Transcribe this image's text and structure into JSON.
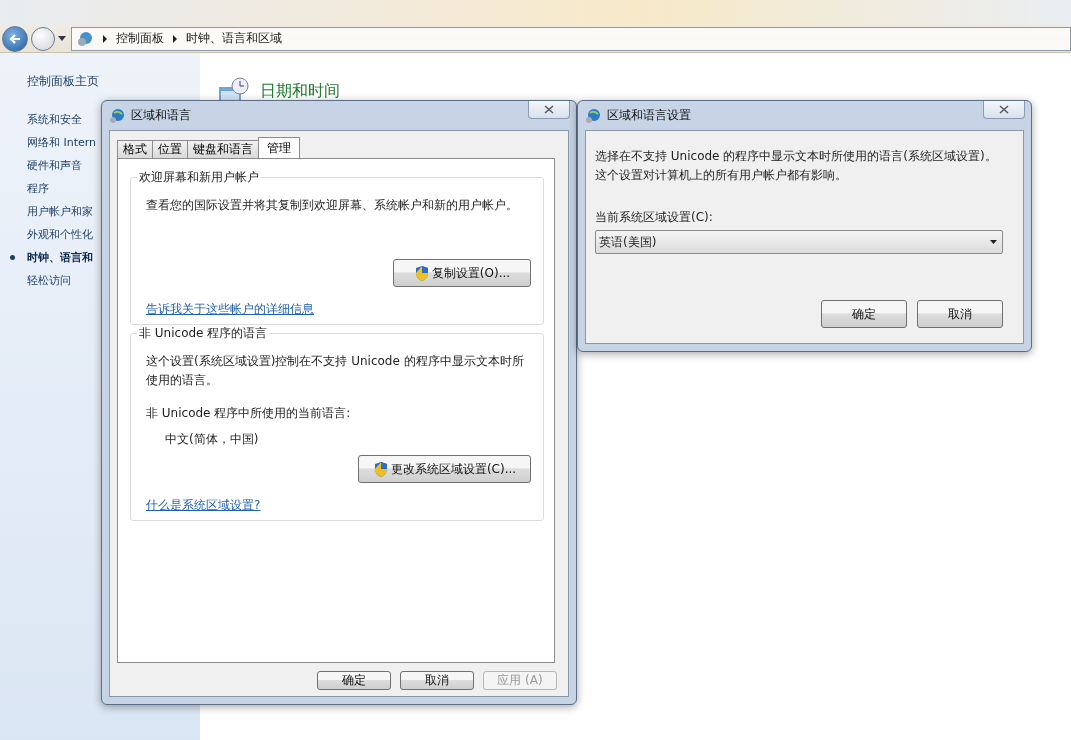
{
  "window": {
    "breadcrumb": [
      "控制面板",
      "时钟、语言和区域"
    ]
  },
  "sidebar": {
    "home": "控制面板主页",
    "items": [
      {
        "label": "系统和安全",
        "selected": false
      },
      {
        "label": "网络和 Intern",
        "selected": false
      },
      {
        "label": "硬件和声音",
        "selected": false
      },
      {
        "label": "程序",
        "selected": false
      },
      {
        "label": "用户帐户和家",
        "selected": false
      },
      {
        "label": "外观和个性化",
        "selected": false
      },
      {
        "label": "时钟、语言和",
        "selected": true
      },
      {
        "label": "轻松访问",
        "selected": false
      }
    ]
  },
  "main": {
    "heading": "日期和时间"
  },
  "region_dialog": {
    "title": "区域和语言",
    "tabs": [
      {
        "label": "格式",
        "selected": false
      },
      {
        "label": "位置",
        "selected": false
      },
      {
        "label": "键盘和语言",
        "selected": false
      },
      {
        "label": "管理",
        "selected": true
      }
    ],
    "groups": [
      {
        "title": "欢迎屏幕和新用户帐户",
        "text": "查看您的国际设置并将其复制到欢迎屏幕、系统帐户和新的用户帐户。",
        "button": "复制设置(O)...",
        "link": "告诉我关于这些帐户的详细信息"
      },
      {
        "title": "非 Unicode 程序的语言",
        "text": "这个设置(系统区域设置)控制在不支持 Unicode 的程序中显示文本时所使用的语言。",
        "current_label": "非 Unicode 程序中所使用的当前语言:",
        "current_value": "中文(简体，中国)",
        "button": "更改系统区域设置(C)...",
        "link": "什么是系统区域设置?"
      }
    ],
    "buttons": [
      {
        "label": "确定",
        "disabled": false
      },
      {
        "label": "取消",
        "disabled": false
      },
      {
        "label": "应用 (A)",
        "disabled": true
      }
    ]
  },
  "locale_dialog": {
    "title": "区域和语言设置",
    "text": "选择在不支持 Unicode 的程序中显示文本时所使用的语言(系统区域设置)。这个设置对计算机上的所有用户帐户都有影响。",
    "field_label": "当前系统区域设置(C):",
    "value": "英语(美国)",
    "buttons": [
      {
        "label": "确定",
        "disabled": false
      },
      {
        "label": "取消",
        "disabled": false
      }
    ]
  }
}
